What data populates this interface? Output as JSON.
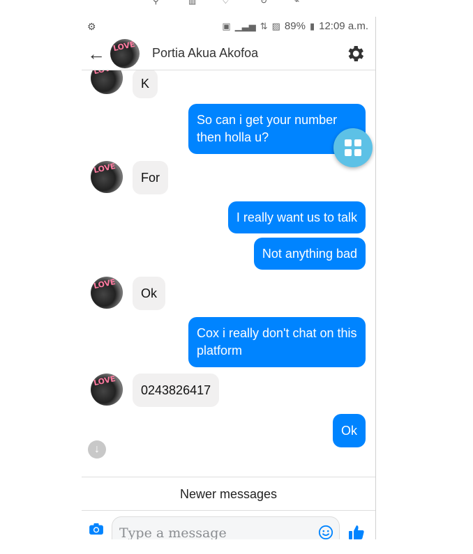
{
  "status_bar": {
    "left_icon": "notification-icon",
    "battery": "89%",
    "time": "12:09 a.m."
  },
  "header": {
    "contact_name": "Portia Akua Akofoa",
    "avatar_text": "LOVE",
    "back_icon": "back-arrow-icon",
    "settings_icon": "gear-icon"
  },
  "messages": [
    {
      "direction": "in",
      "text": "K"
    },
    {
      "direction": "out",
      "text": "So can i get your number then holla u?"
    },
    {
      "direction": "in",
      "text": "For"
    },
    {
      "direction": "out",
      "text": "I really want us to talk"
    },
    {
      "direction": "out",
      "text": "Not anything bad"
    },
    {
      "direction": "in",
      "text": "Ok"
    },
    {
      "direction": "out",
      "text": "Cox i really don't chat on this platform"
    },
    {
      "direction": "in",
      "text": "0243826417"
    },
    {
      "direction": "out",
      "text": "Ok"
    }
  ],
  "newer_messages": "Newer messages",
  "composer": {
    "placeholder": "Type a message",
    "camera_icon": "camera-icon",
    "emoji_icon": "emoji-icon",
    "like_icon": "thumbs-up-icon"
  },
  "colors": {
    "accent": "#0084ff",
    "incoming_bubble": "#f1f0f0",
    "fab": "#5dc1e6"
  }
}
